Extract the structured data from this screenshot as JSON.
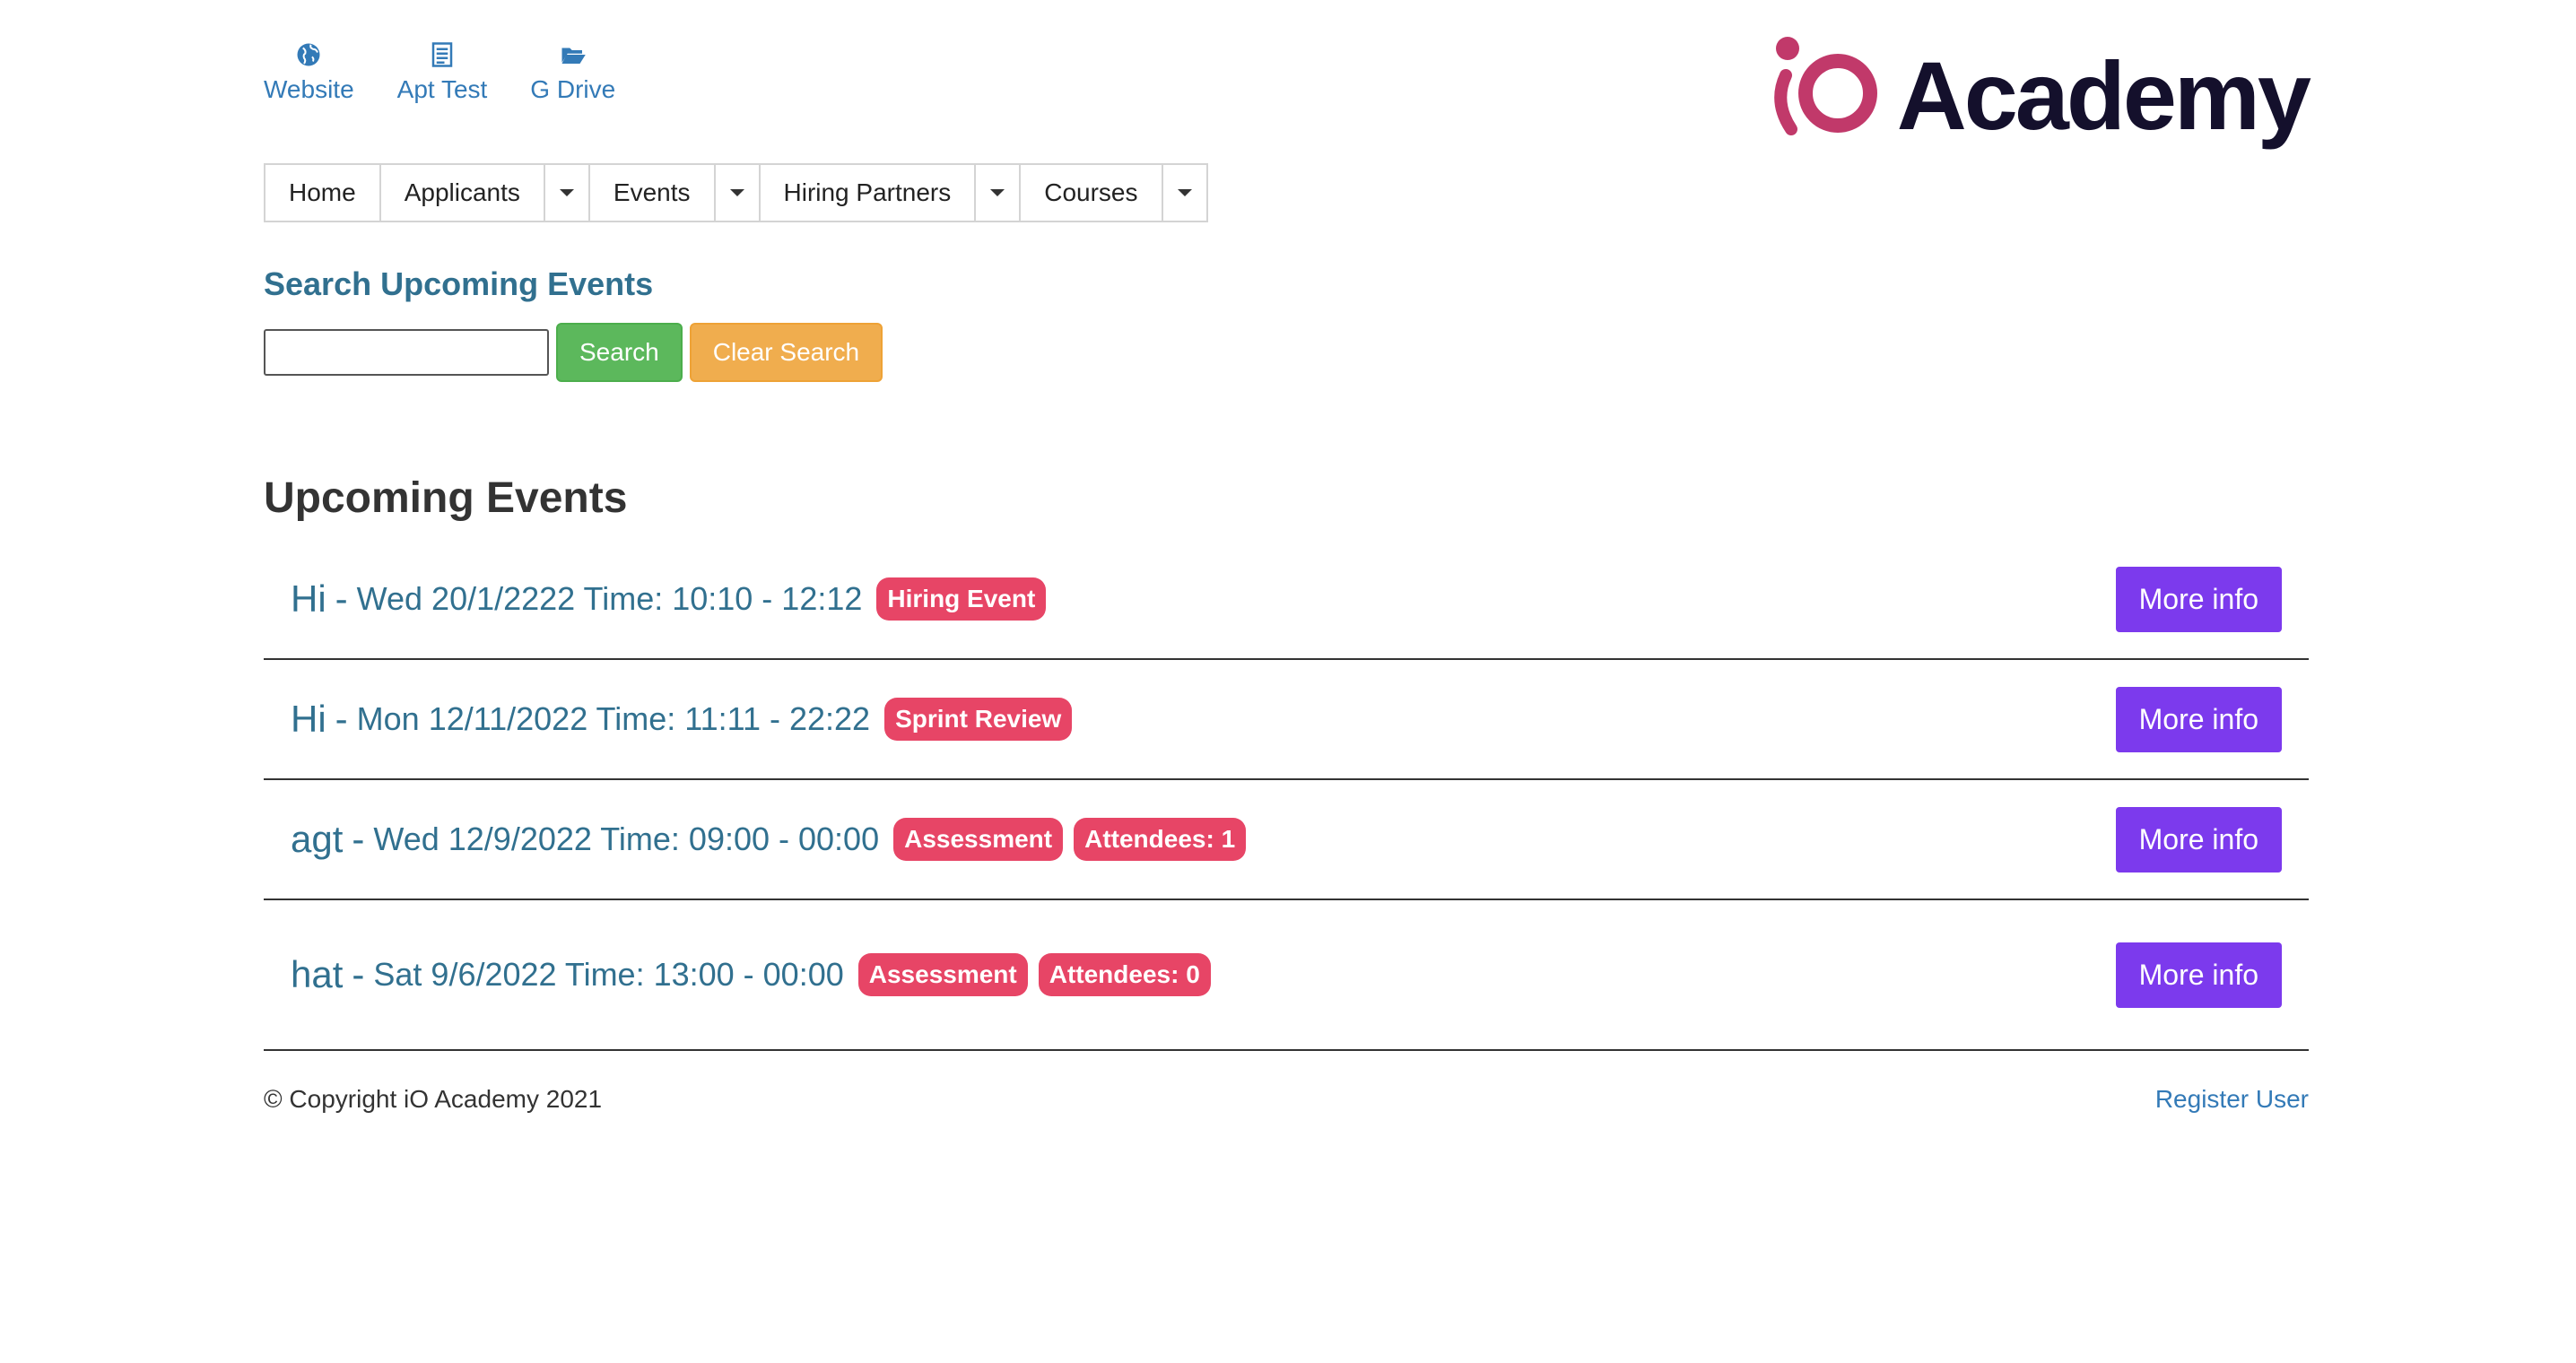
{
  "quick_links": [
    {
      "label": "Website",
      "icon": "globe-icon"
    },
    {
      "label": "Apt Test",
      "icon": "document-icon"
    },
    {
      "label": "G Drive",
      "icon": "folder-open-icon"
    }
  ],
  "logo": {
    "mark": "iO",
    "text": "Academy",
    "brand_color": "#c1396a",
    "text_color": "#14102c"
  },
  "nav": {
    "home": "Home",
    "applicants": "Applicants",
    "events": "Events",
    "hiring_partners": "Hiring Partners",
    "courses": "Courses"
  },
  "search": {
    "heading": "Search Upcoming Events",
    "input_value": "",
    "search_label": "Search",
    "clear_label": "Clear Search"
  },
  "events": {
    "heading": "Upcoming Events",
    "items": [
      {
        "name": "Hi",
        "when": "Wed 20/1/2222 Time: 10:10 - 12:12",
        "badges": [
          "Hiring Event"
        ],
        "button": "More info"
      },
      {
        "name": "Hi",
        "when": "Mon 12/11/2022 Time: 11:11 - 22:22",
        "badges": [
          "Sprint Review"
        ],
        "button": "More info"
      },
      {
        "name": "agt",
        "when": "Wed 12/9/2022 Time: 09:00 - 00:00",
        "badges": [
          "Assessment",
          "Attendees: 1"
        ],
        "button": "More info"
      },
      {
        "name": "hat",
        "when": "Sat 9/6/2022 Time: 13:00 - 00:00",
        "badges": [
          "Assessment",
          "Attendees: 0"
        ],
        "button": "More info"
      }
    ]
  },
  "footer": {
    "copyright": "© Copyright iO Academy 2021",
    "register_link": "Register User"
  },
  "colors": {
    "accent_purple": "#7c3aed",
    "badge_red": "#e74566",
    "link_blue": "#337ab7",
    "heading_teal": "#31708f"
  }
}
